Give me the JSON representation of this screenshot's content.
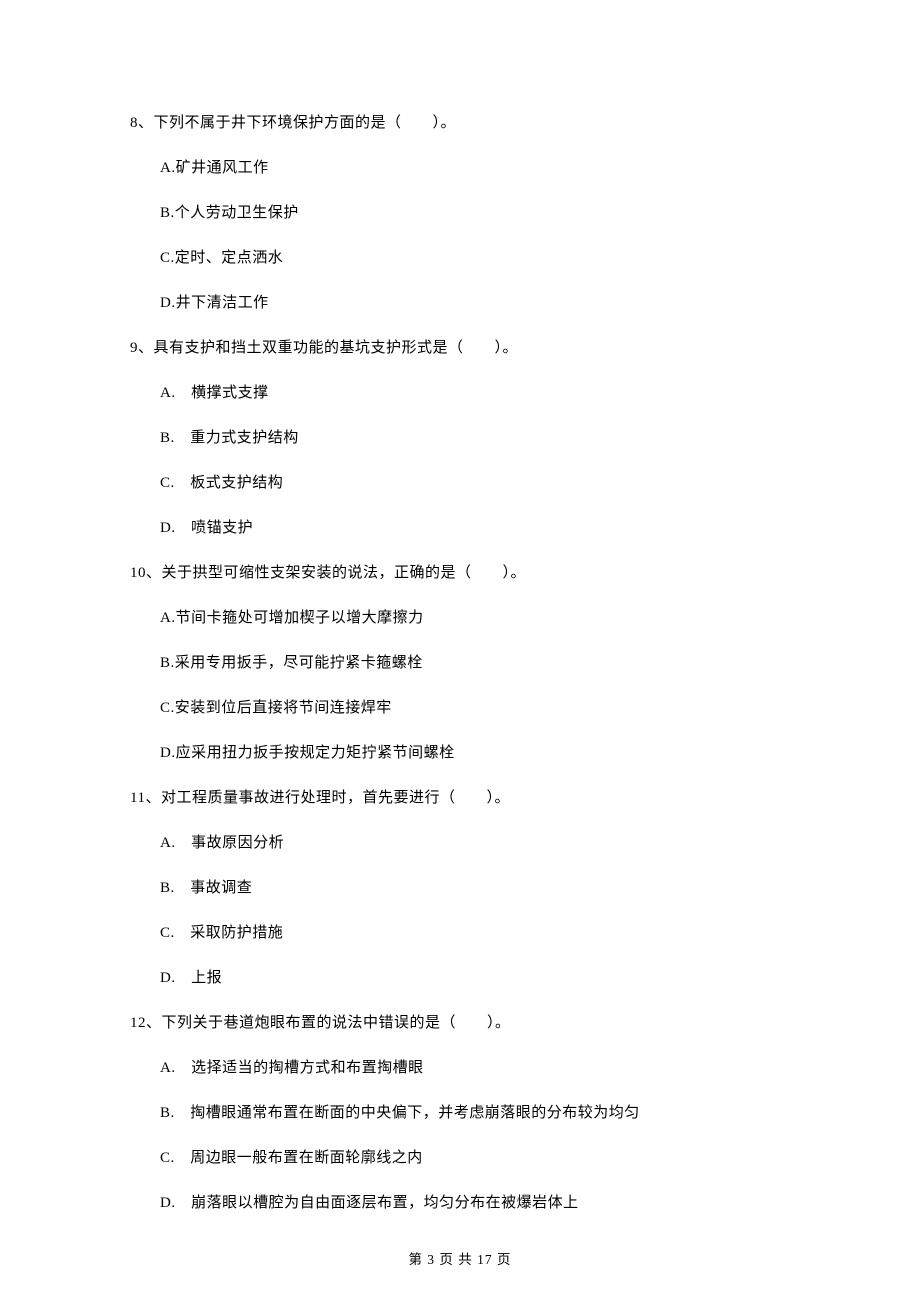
{
  "questions": [
    {
      "number": "8、",
      "text": "下列不属于井下环境保护方面的是（　　）。",
      "options": [
        "A.矿井通风工作",
        "B.个人劳动卫生保护",
        "C.定时、定点洒水",
        "D.井下清洁工作"
      ]
    },
    {
      "number": "9、",
      "text": "具有支护和挡土双重功能的基坑支护形式是（　　）。",
      "options": [
        "A.　横撑式支撑",
        "B.　重力式支护结构",
        "C.　板式支护结构",
        "D.　喷锚支护"
      ]
    },
    {
      "number": "10、",
      "text": "关于拱型可缩性支架安装的说法，正确的是（　　）。",
      "options": [
        "A.节间卡箍处可增加楔子以增大摩擦力",
        "B.采用专用扳手，尽可能拧紧卡箍螺栓",
        "C.安装到位后直接将节间连接焊牢",
        "D.应采用扭力扳手按规定力矩拧紧节间螺栓"
      ]
    },
    {
      "number": "11、",
      "text": "对工程质量事故进行处理时，首先要进行（　　）。",
      "options": [
        "A.　事故原因分析",
        "B.　事故调查",
        "C.　采取防护措施",
        "D.　上报"
      ]
    },
    {
      "number": "12、",
      "text": "下列关于巷道炮眼布置的说法中错误的是（　　）。",
      "options": [
        "A.　选择适当的掏槽方式和布置掏槽眼",
        "B.　掏槽眼通常布置在断面的中央偏下，并考虑崩落眼的分布较为均匀",
        "C.　周边眼一般布置在断面轮廓线之内",
        "D.　崩落眼以槽腔为自由面逐层布置，均匀分布在被爆岩体上"
      ]
    }
  ],
  "pager": "第 3 页 共 17 页"
}
